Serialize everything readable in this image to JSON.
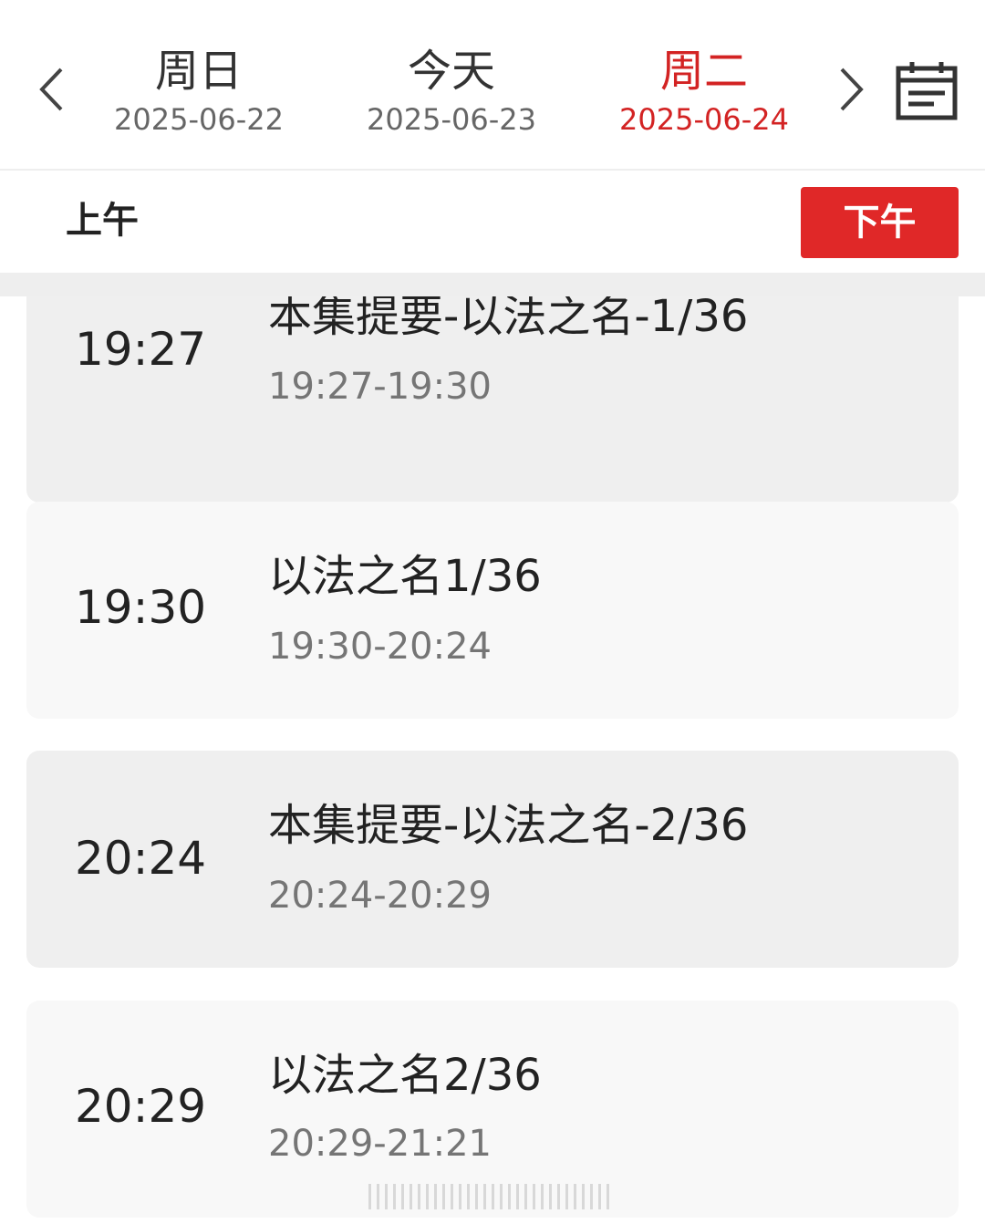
{
  "date_nav": {
    "prev_icon": "chevron-left-icon",
    "next_icon": "chevron-right-icon",
    "calendar_icon": "calendar-icon",
    "days": [
      {
        "name": "周日",
        "date": "2025-06-22",
        "selected": false
      },
      {
        "name": "今天",
        "date": "2025-06-23",
        "selected": false
      },
      {
        "name": "周二",
        "date": "2025-06-24",
        "selected": true
      }
    ]
  },
  "period": {
    "am_label": "上午",
    "pm_label": "下午",
    "active": "pm"
  },
  "colors": {
    "accent": "#e02828",
    "selected_text": "#d32323",
    "card_dark": "#efefef",
    "card_light": "#f8f8f8"
  },
  "schedule": [
    {
      "start": "19:27",
      "title": "本集提要-以法之名-1/36",
      "range": "19:27-19:30"
    },
    {
      "start": "19:30",
      "title": "以法之名1/36",
      "range": "19:30-20:24"
    },
    {
      "start": "20:24",
      "title": "本集提要-以法之名-2/36",
      "range": "20:24-20:29"
    },
    {
      "start": "20:29",
      "title": "以法之名2/36",
      "range": "20:29-21:21"
    }
  ]
}
